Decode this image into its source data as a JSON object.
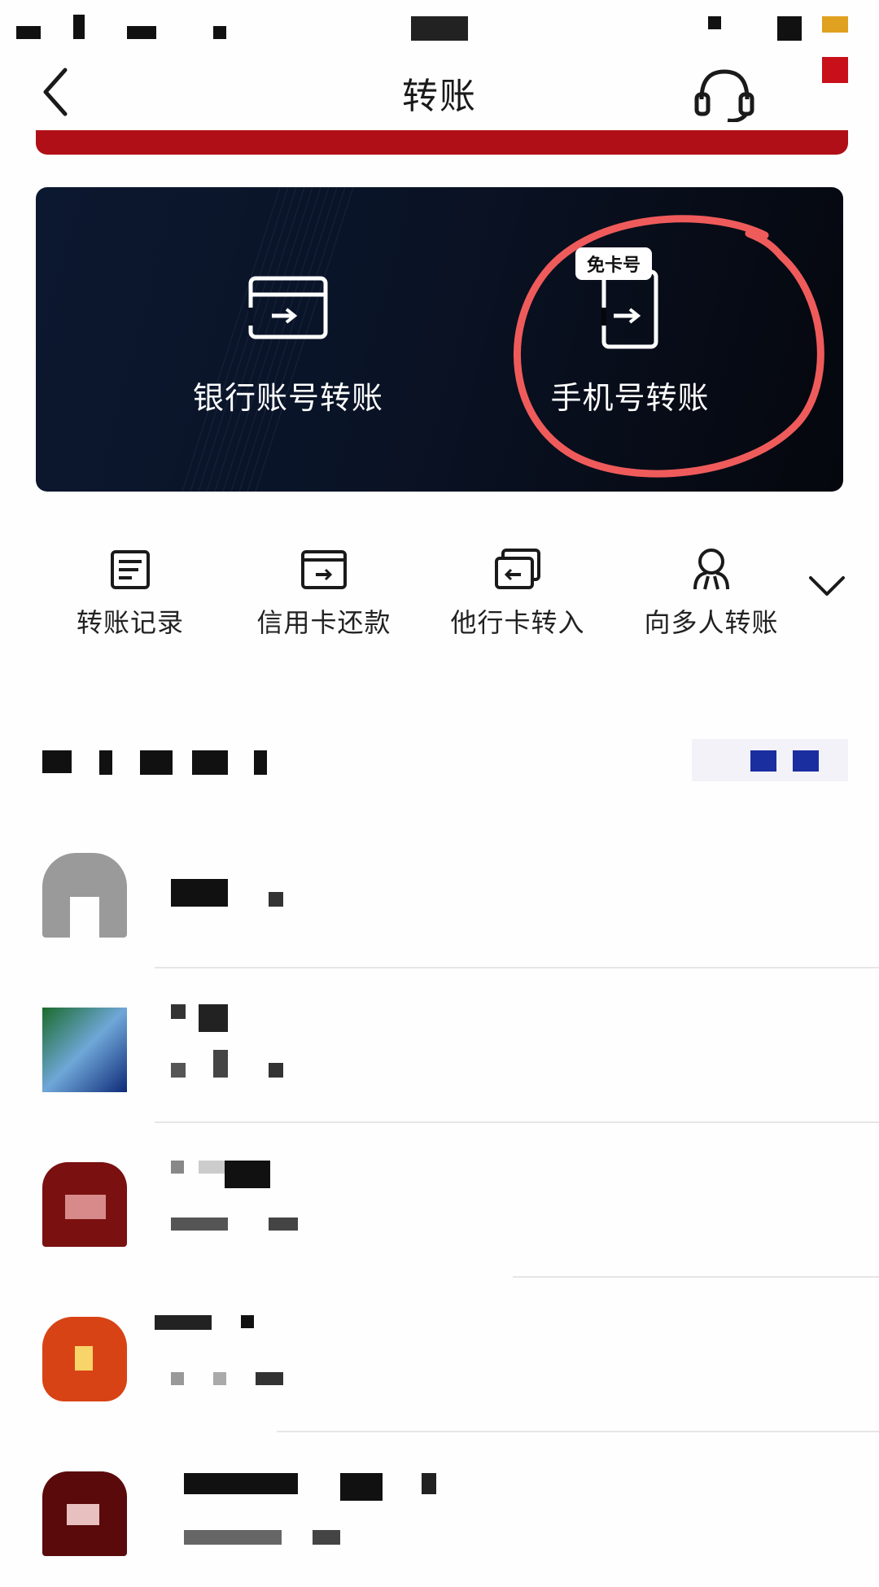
{
  "nav": {
    "title": "转账"
  },
  "card": {
    "bank_transfer_label": "银行账号转账",
    "phone_transfer_label": "手机号转账",
    "phone_badge": "免卡号"
  },
  "quick_actions": [
    {
      "label": "转账记录",
      "icon": "list-icon"
    },
    {
      "label": "信用卡还款",
      "icon": "card-icon"
    },
    {
      "label": "他行卡转入",
      "icon": "exchange-icon"
    },
    {
      "label": "向多人转账",
      "icon": "people-icon"
    }
  ],
  "colors": {
    "brand_red": "#b10f17",
    "card_dark": "#0a1326",
    "annotation_red": "#ef5b5b"
  }
}
